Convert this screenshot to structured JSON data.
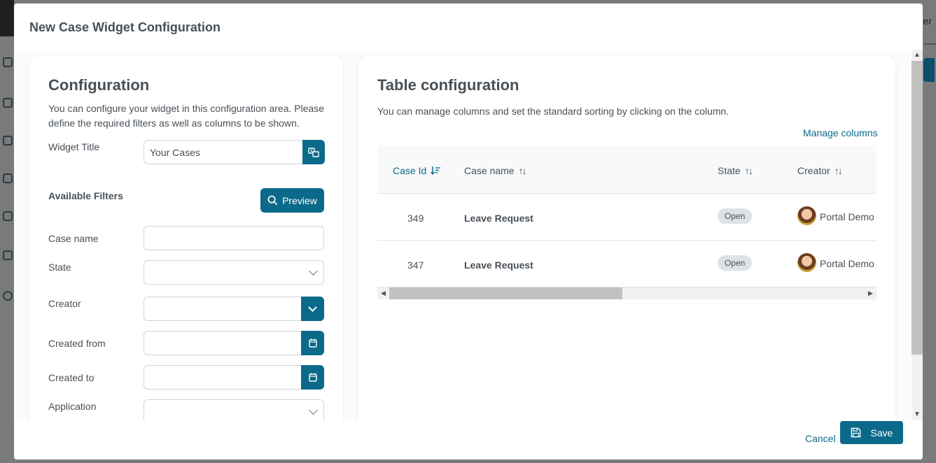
{
  "background": {
    "user_fragment": "er"
  },
  "modal": {
    "title": "New Case Widget Configuration"
  },
  "configuration": {
    "heading": "Configuration",
    "description": "You can configure your widget in this configuration area. Please define the required filters as well as columns to be shown.",
    "widget_title_label": "Widget Title",
    "widget_title_value": "Your Cases",
    "available_filters": "Available Filters",
    "preview_label": "Preview",
    "filters": {
      "case_name": "Case name",
      "state": "State",
      "creator": "Creator",
      "created_from": "Created from",
      "created_to": "Created to",
      "application": "Application"
    }
  },
  "table_config": {
    "heading": "Table configuration",
    "description": "You can manage columns and set the standard sorting by clicking on the column.",
    "manage_columns": "Manage columns",
    "columns": [
      "Case Id",
      "Case name",
      "State",
      "Creator"
    ],
    "rows": [
      {
        "id": "349",
        "name": "Leave Request",
        "state": "Open",
        "creator": "Portal Demo"
      },
      {
        "id": "347",
        "name": "Leave Request",
        "state": "Open",
        "creator": "Portal Demo"
      }
    ]
  },
  "footer": {
    "cancel": "Cancel",
    "save": "Save"
  },
  "colors": {
    "primary": "#0b6a8a",
    "text": "#495057",
    "badge": "#dee2e6"
  }
}
